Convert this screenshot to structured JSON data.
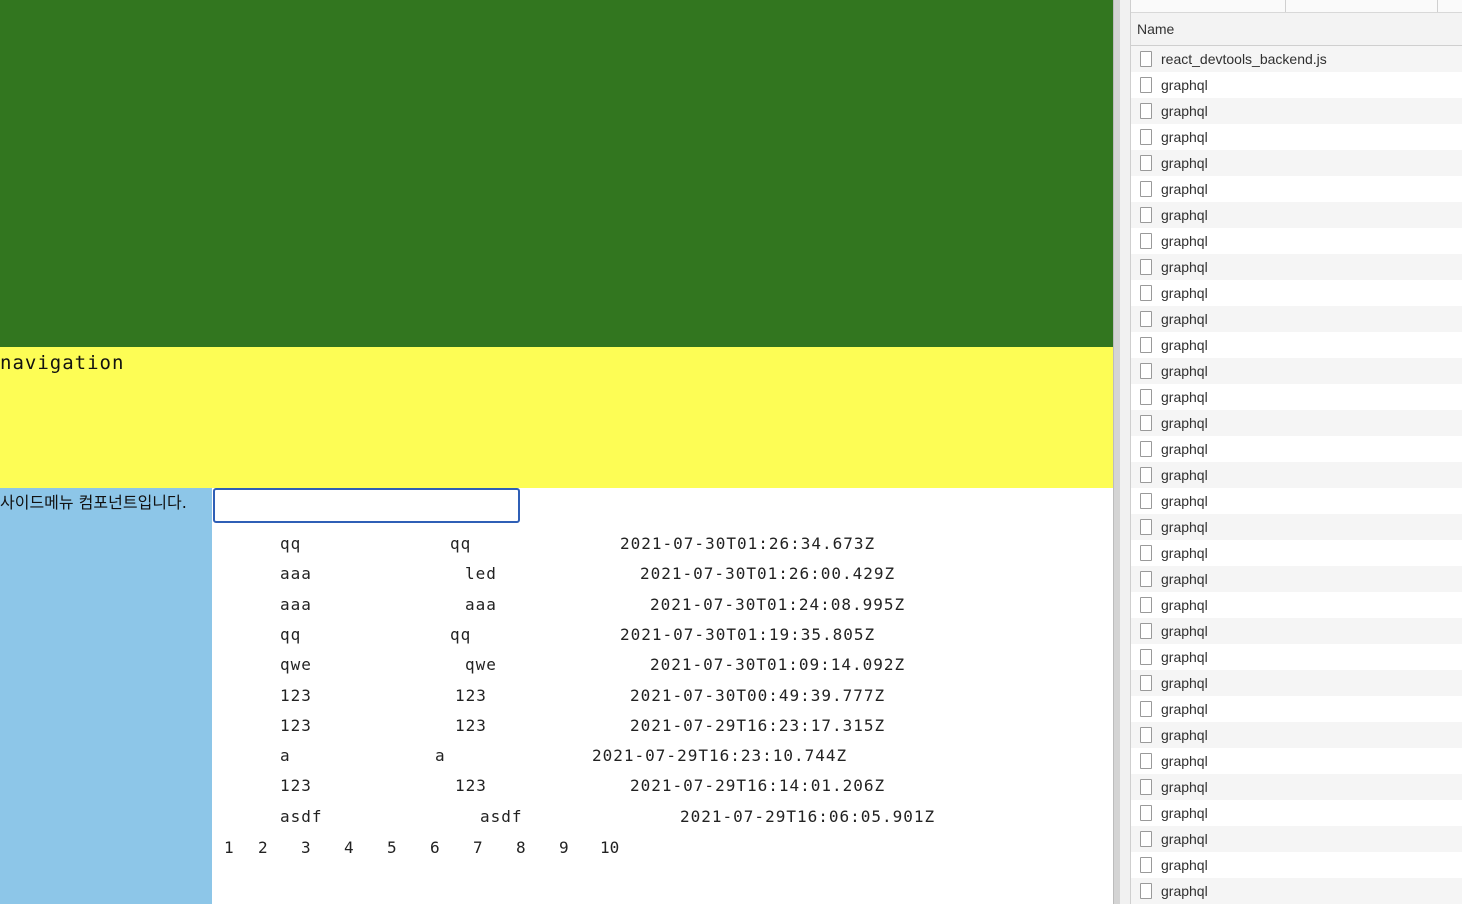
{
  "colors": {
    "header_bg": "#32761f",
    "nav_bg": "#fdfd55",
    "sidebar_bg": "#8dc6e8",
    "input_border": "#2f5fb6"
  },
  "nav": {
    "title": "navigation"
  },
  "sidebar": {
    "title": "사이드메뉴 컴포넌트입니다."
  },
  "search": {
    "value": "",
    "placeholder": ""
  },
  "table": {
    "rows": [
      [
        "qq",
        "qq",
        "2021-07-30T01:26:34.673Z"
      ],
      [
        "aaa",
        "led",
        "2021-07-30T01:26:00.429Z"
      ],
      [
        "aaa",
        "aaa",
        "2021-07-30T01:24:08.995Z"
      ],
      [
        "qq",
        "qq",
        "2021-07-30T01:19:35.805Z"
      ],
      [
        "qwe",
        "qwe",
        "2021-07-30T01:09:14.092Z"
      ],
      [
        "123",
        "123",
        "2021-07-30T00:49:39.777Z"
      ],
      [
        "123",
        "123",
        "2021-07-29T16:23:17.315Z"
      ],
      [
        "a",
        "a",
        "2021-07-29T16:23:10.744Z"
      ],
      [
        "123",
        "123",
        "2021-07-29T16:14:01.206Z"
      ],
      [
        "asdf",
        "asdf",
        "2021-07-29T16:06:05.901Z"
      ]
    ]
  },
  "pagination": {
    "pages": [
      "1",
      "2",
      "3",
      "4",
      "5",
      "6",
      "7",
      "8",
      "9",
      "10"
    ]
  },
  "devtools": {
    "column_header": "Name",
    "requests": [
      "react_devtools_backend.js",
      "graphql",
      "graphql",
      "graphql",
      "graphql",
      "graphql",
      "graphql",
      "graphql",
      "graphql",
      "graphql",
      "graphql",
      "graphql",
      "graphql",
      "graphql",
      "graphql",
      "graphql",
      "graphql",
      "graphql",
      "graphql",
      "graphql",
      "graphql",
      "graphql",
      "graphql",
      "graphql",
      "graphql",
      "graphql",
      "graphql",
      "graphql",
      "graphql",
      "graphql",
      "graphql",
      "graphql",
      "graphql"
    ]
  }
}
